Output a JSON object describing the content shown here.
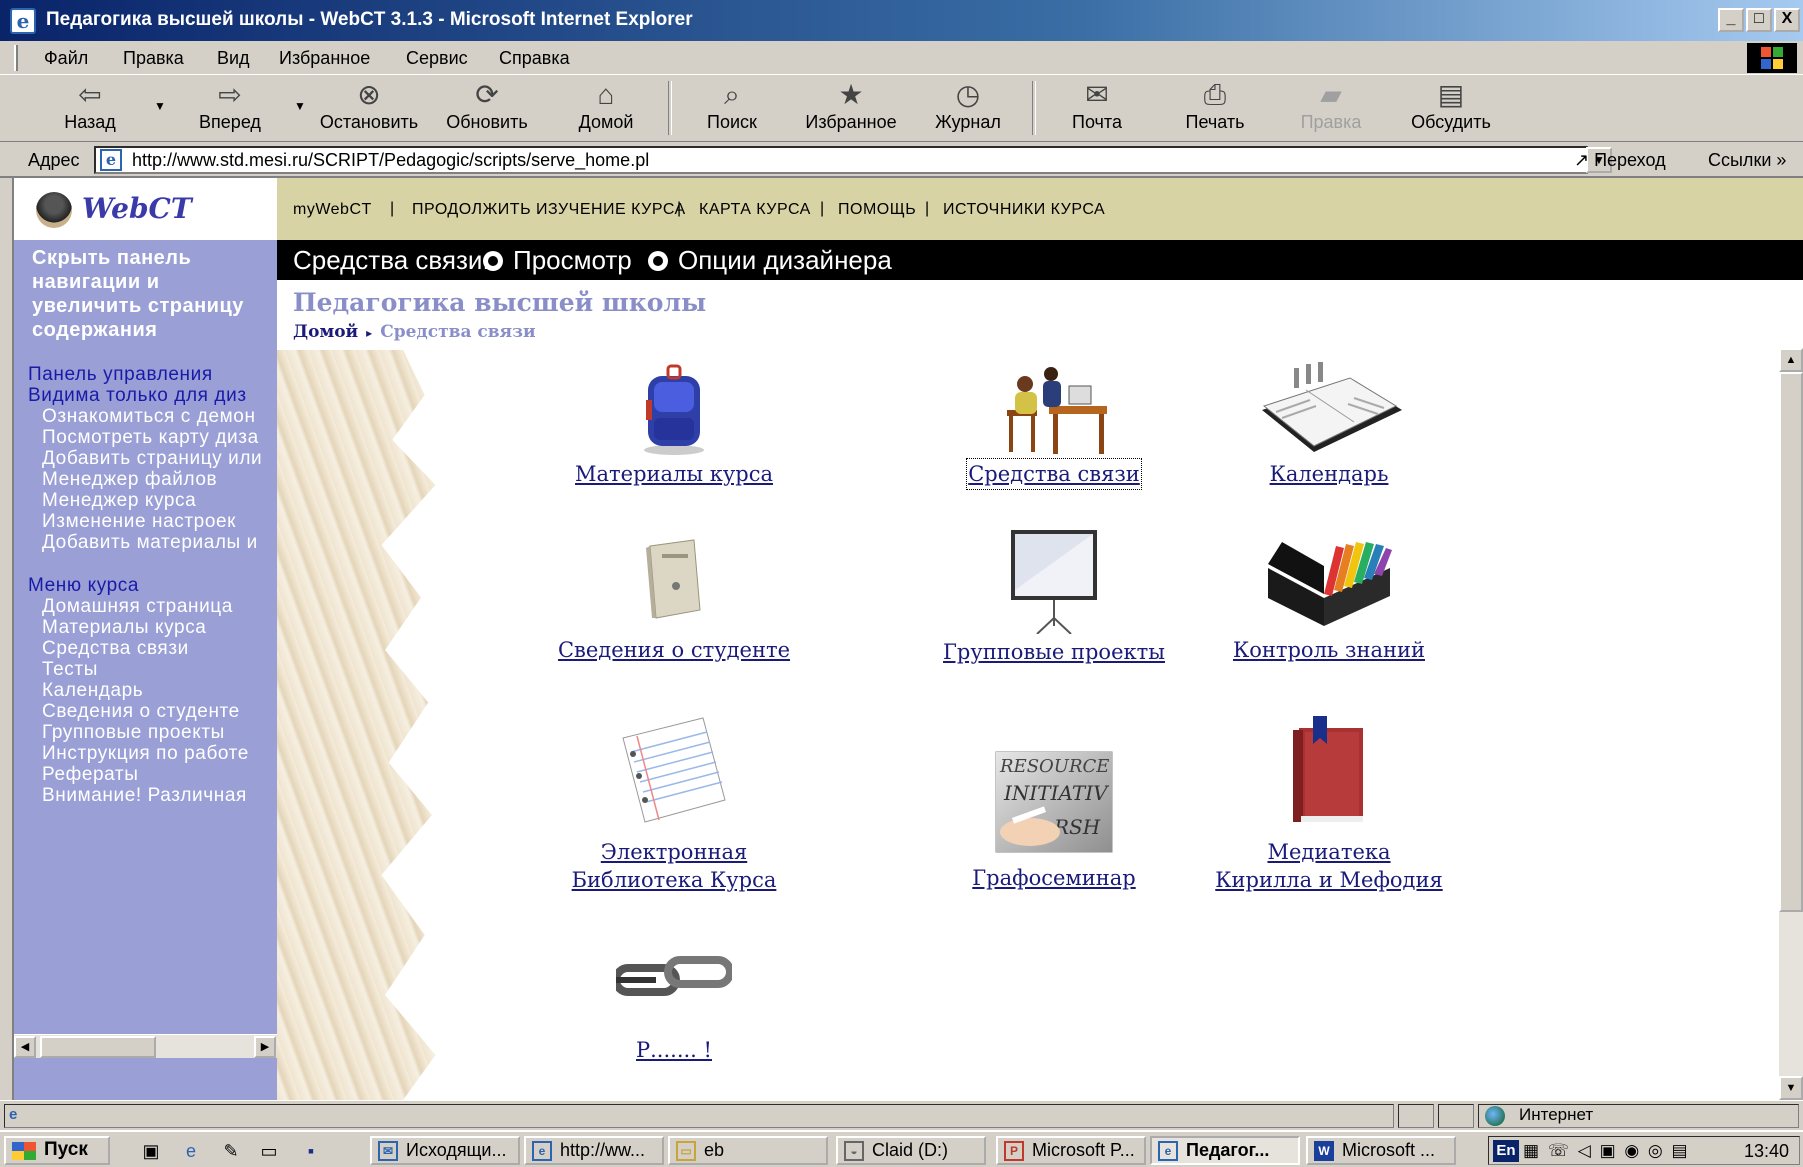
{
  "window": {
    "title": "Педагогика высшей школы - WebCT 3.1.3 - Microsoft Internet Explorer",
    "controls": [
      "_",
      "□",
      "X"
    ]
  },
  "menu": [
    "Файл",
    "Правка",
    "Вид",
    "Избранное",
    "Сервис",
    "Справка"
  ],
  "toolbar": {
    "back": "Назад",
    "forward": "Вперед",
    "stop": "Остановить",
    "refresh": "Обновить",
    "home": "Домой",
    "search": "Поиск",
    "favorites": "Избранное",
    "history": "Журнал",
    "mail": "Почта",
    "print": "Печать",
    "edit": "Правка",
    "discuss": "Обсудить"
  },
  "address": {
    "label": "Адрес",
    "url": "http://www.std.mesi.ru/SCRIPT/Pedagogic/scripts/serve_home.pl",
    "go": "Переход",
    "links": "Ссылки"
  },
  "webct": {
    "logo": "WebCT",
    "top_nav": [
      "myWebCT",
      "ПРОДОЛЖИТЬ ИЗУЧЕНИЕ КУРСА",
      "КАРТА КУРСА",
      "ПОМОЩЬ",
      "ИСТОЧНИКИ КУРСА"
    ],
    "tool_label": "Средства связи:",
    "view_option": "Просмотр",
    "designer_option": "Опции дизайнера",
    "course_title": "Педагогика высшей школы",
    "breadcrumb_home": "Домой",
    "breadcrumb_current": "Средства связи"
  },
  "left_nav": {
    "hide_link": "Скрыть панель навигации и увеличить страницу содержания",
    "control_panel": "Панель управления",
    "designer_only": "Видима только для диз",
    "control_items": [
      "Ознакомиться с демон",
      "Посмотреть карту диза",
      "Добавить страницу или",
      "Менеджер файлов",
      "Менеджер курса",
      "Изменение настроек",
      "Добавить материалы и"
    ],
    "course_menu": "Меню курса",
    "course_items": [
      "Домашняя страница",
      "Материалы курса",
      "Средства связи",
      "Тесты",
      "Календарь",
      "Сведения о студенте",
      "Групповые проекты",
      "Инструкция по работе",
      "Рефераты",
      "Внимание! Различная"
    ]
  },
  "tiles": [
    {
      "label": "Материалы курса",
      "icon": "backpack-icon"
    },
    {
      "label": "Средства связи",
      "icon": "desk-icon"
    },
    {
      "label": "Календарь",
      "icon": "calendar-icon"
    },
    {
      "label": "Сведения о студенте",
      "icon": "booklet-icon"
    },
    {
      "label": "Групповые проекты",
      "icon": "projector-screen-icon"
    },
    {
      "label": "Контроль знаний",
      "icon": "file-sorter-icon"
    },
    {
      "label": "Электронная",
      "label2": "Библиотека Курса",
      "icon": "notepad-icon"
    },
    {
      "label": "Графосеминар",
      "icon": "resource-photo-icon"
    },
    {
      "label": "Медиатека",
      "label2": "Кирилла и Мефодия",
      "icon": "book-icon"
    },
    {
      "label": "Р....... !",
      "icon": "chain-icon"
    }
  ],
  "status": {
    "zone": "Интернет"
  },
  "taskbar": {
    "start": "Пуск",
    "tasks": [
      "Исходящи...",
      "http://ww...",
      "eb",
      "Claid (D:)",
      "Microsoft P...",
      "Педагог...",
      "Microsoft ..."
    ],
    "lang": "En",
    "clock": "13:40"
  }
}
